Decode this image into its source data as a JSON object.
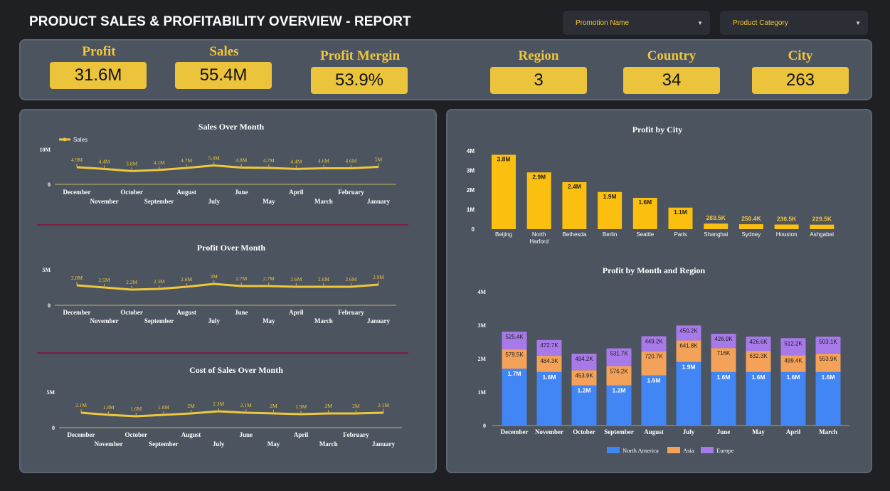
{
  "header": {
    "title": "PRODUCT SALES & PROFITABILITY OVERVIEW - REPORT",
    "filters": [
      {
        "label": "Promotion Name",
        "icon": "chevron-down-icon"
      },
      {
        "label": "Product Category",
        "icon": "chevron-down-icon"
      }
    ]
  },
  "kpis": [
    {
      "label": "Profit",
      "value": "31.6M"
    },
    {
      "label": "Sales",
      "value": "55.4M"
    },
    {
      "label": "Profit Mergin",
      "value": "53.9%"
    },
    {
      "label": "Region",
      "value": "3"
    },
    {
      "label": "Country",
      "value": "34"
    },
    {
      "label": "City",
      "value": "263"
    }
  ],
  "colors": {
    "accent": "#f0c73a",
    "panel": "#4b545f",
    "bar": "#fbbf0f",
    "north_america": "#4285f4",
    "asia": "#f4a259",
    "europe": "#a779e9",
    "divider": "#7b1f45"
  },
  "chart_data": [
    {
      "type": "line",
      "title": "Sales Over Month",
      "legend": [
        "Sales"
      ],
      "legend_position": "top-left",
      "categories": [
        "December",
        "November",
        "October",
        "September",
        "August",
        "July",
        "June",
        "May",
        "April",
        "March",
        "February",
        "January"
      ],
      "series": [
        {
          "name": "Sales",
          "values": [
            4.9,
            4.4,
            3.8,
            4.1,
            4.7,
            5.4,
            4.8,
            4.7,
            4.4,
            4.6,
            4.6,
            5.0
          ]
        }
      ],
      "data_labels": [
        "4.9M",
        "4.4M",
        "3.8M",
        "4.1M",
        "4.7M",
        "5.4M",
        "4.8M",
        "4.7M",
        "4.4M",
        "4.6M",
        "4.6M",
        "5M"
      ],
      "y_ticks": [
        "0",
        "10M"
      ],
      "ylim": [
        0,
        10
      ]
    },
    {
      "type": "line",
      "title": "Profit Over Month",
      "categories": [
        "December",
        "November",
        "October",
        "September",
        "August",
        "July",
        "June",
        "May",
        "April",
        "March",
        "February",
        "January"
      ],
      "series": [
        {
          "values": [
            2.8,
            2.5,
            2.2,
            2.3,
            2.6,
            3.0,
            2.7,
            2.7,
            2.6,
            2.6,
            2.6,
            2.9
          ]
        }
      ],
      "data_labels": [
        "2.8M",
        "2.5M",
        "2.2M",
        "2.3M",
        "2.6M",
        "3M",
        "2.7M",
        "2.7M",
        "2.6M",
        "2.6M",
        "2.6M",
        "2.9M"
      ],
      "y_ticks": [
        "0",
        "5M"
      ],
      "ylim": [
        0,
        5
      ]
    },
    {
      "type": "line",
      "title": "Cost of Sales Over Month",
      "categories": [
        "December",
        "November",
        "October",
        "September",
        "August",
        "July",
        "June",
        "May",
        "April",
        "March",
        "February",
        "January"
      ],
      "series": [
        {
          "values": [
            2.1,
            1.8,
            1.6,
            1.8,
            2.0,
            2.3,
            2.1,
            2.0,
            1.9,
            2.0,
            2.0,
            2.1
          ]
        }
      ],
      "data_labels": [
        "2.1M",
        "1.8M",
        "1.6M",
        "1.8M",
        "2M",
        "2.3M",
        "2.1M",
        "2M",
        "1.9M",
        "2M",
        "2M",
        "2.1M"
      ],
      "y_ticks": [
        "0",
        "5M"
      ],
      "ylim": [
        0,
        5
      ]
    },
    {
      "type": "bar",
      "title": "Profit by City",
      "categories": [
        "Beijing",
        "North Harford",
        "Bethesda",
        "Berlin",
        "Seattle",
        "Paris",
        "Shanghai",
        "Sydney",
        "Houston",
        "Ashgabat"
      ],
      "values": [
        3.8,
        2.9,
        2.4,
        1.9,
        1.6,
        1.1,
        0.2835,
        0.2504,
        0.2365,
        0.2295
      ],
      "data_labels": [
        "3.8M",
        "2.9M",
        "2.4M",
        "1.9M",
        "1.6M",
        "1.1M",
        "283.5K",
        "250.4K",
        "236.5K",
        "229.5K"
      ],
      "y_ticks": [
        "0",
        "1M",
        "2M",
        "3M",
        "4M"
      ],
      "ylim": [
        0,
        4
      ]
    },
    {
      "type": "bar",
      "stacked": true,
      "title": "Profit by Month and Region",
      "categories": [
        "December",
        "November",
        "October",
        "September",
        "August",
        "July",
        "June",
        "May",
        "April",
        "March"
      ],
      "series": [
        {
          "name": "North America",
          "values": [
            1.7,
            1.6,
            1.2,
            1.2,
            1.5,
            1.9,
            1.6,
            1.6,
            1.6,
            1.6
          ],
          "labels": [
            "1.7M",
            "1.6M",
            "1.2M",
            "1.2M",
            "1.5M",
            "1.9M",
            "1.6M",
            "1.6M",
            "1.6M",
            "1.6M"
          ]
        },
        {
          "name": "Asia",
          "values": [
            0.5795,
            0.4843,
            0.4539,
            0.5762,
            0.7207,
            0.6418,
            0.716,
            0.6323,
            0.4994,
            0.5539
          ],
          "labels": [
            "579.5K",
            "484.3K",
            "453.9K",
            "576.2K",
            "720.7K",
            "641.8K",
            "716K",
            "632.3K",
            "499.4K",
            "553.9K"
          ]
        },
        {
          "name": "Europe",
          "values": [
            0.5254,
            0.4727,
            0.4942,
            0.5317,
            0.4492,
            0.4502,
            0.4269,
            0.4266,
            0.5122,
            0.5031
          ],
          "labels": [
            "525.4K",
            "472.7K",
            "494.2K",
            "531.7K",
            "449.2K",
            "450.2K",
            "426.9K",
            "426.6K",
            "512.2K",
            "503.1K"
          ]
        }
      ],
      "y_ticks": [
        "0",
        "1M",
        "2M",
        "3M",
        "4M"
      ],
      "ylim": [
        0,
        4
      ],
      "legend_position": "bottom"
    }
  ]
}
